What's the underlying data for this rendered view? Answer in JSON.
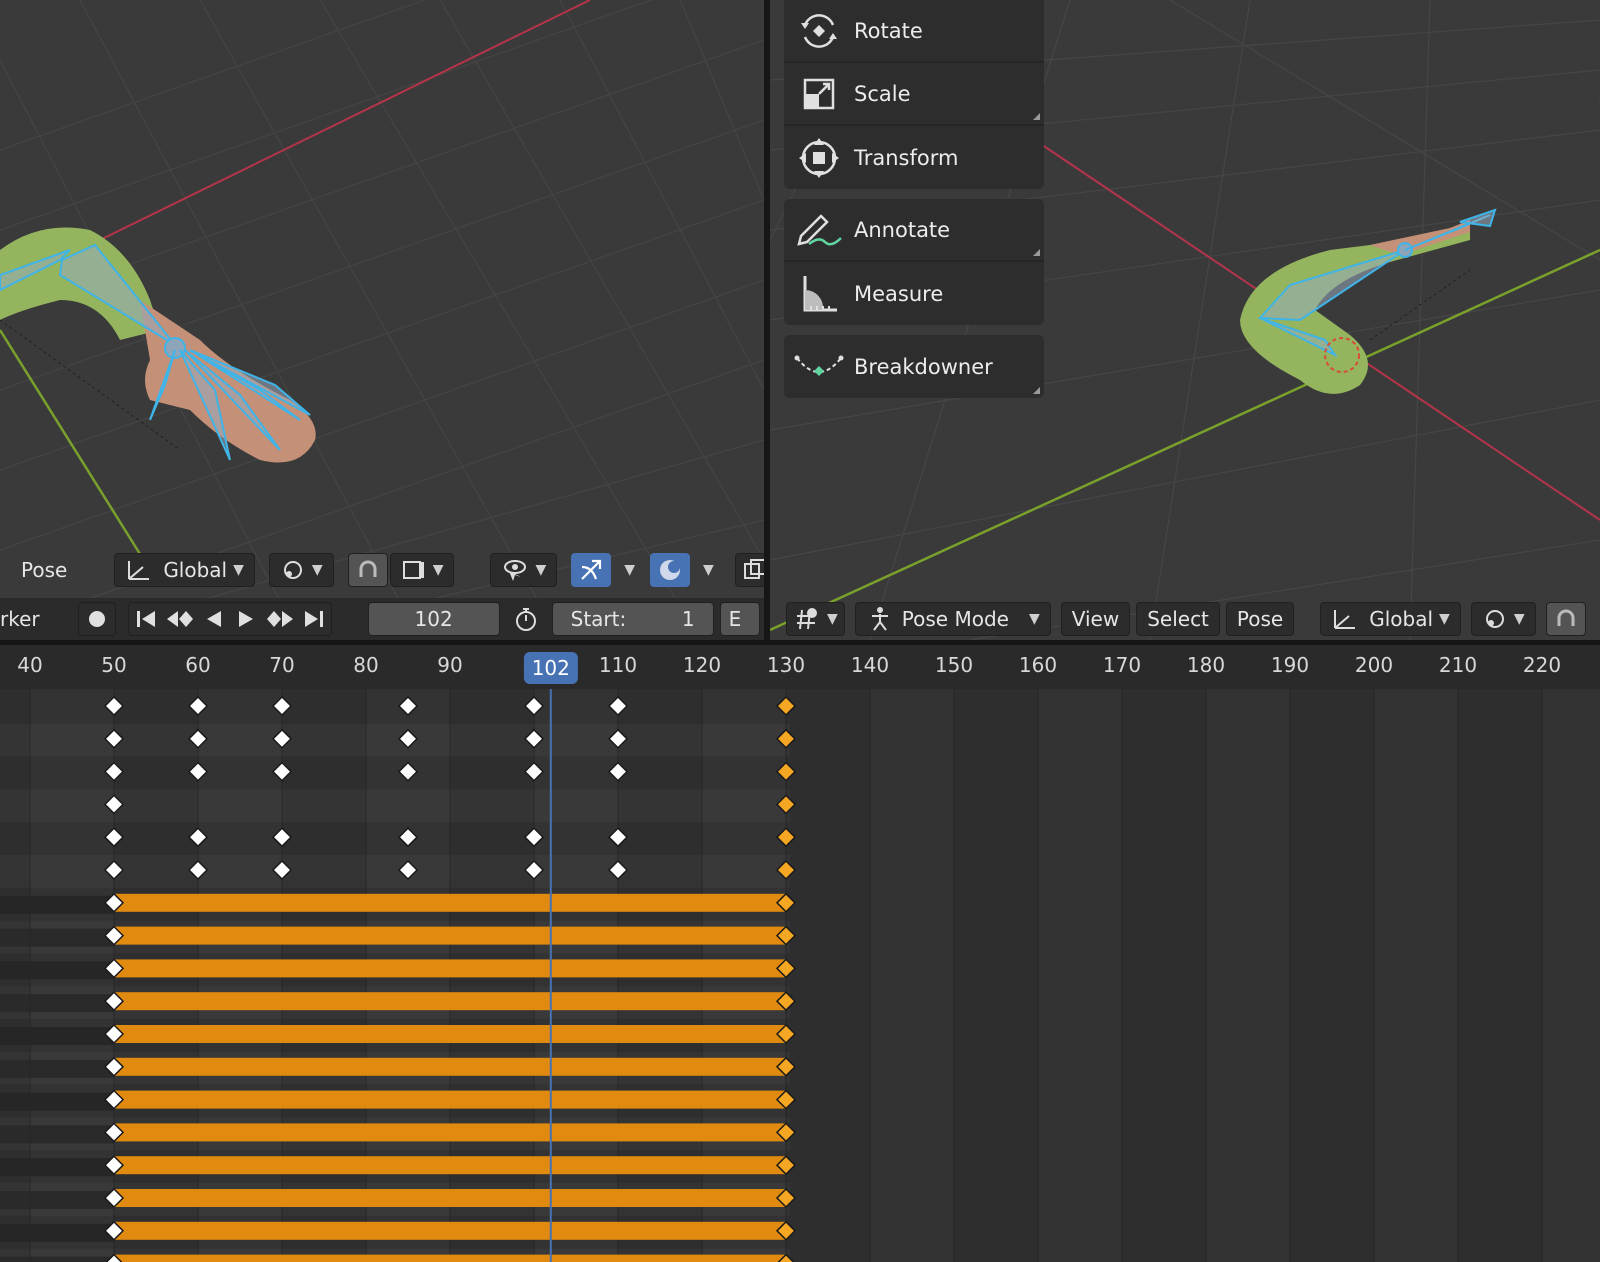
{
  "tools": [
    {
      "label": "Rotate",
      "icon": "rotate-icon"
    },
    {
      "label": "Scale",
      "icon": "scale-icon"
    },
    {
      "label": "Transform",
      "icon": "transform-icon"
    },
    {
      "label": "Annotate",
      "icon": "annotate-icon"
    },
    {
      "label": "Measure",
      "icon": "measure-icon"
    },
    {
      "label": "Breakdowner",
      "icon": "breakdowner-icon"
    }
  ],
  "left_header": {
    "menu_pose": "Pose",
    "orientation": "Global"
  },
  "right_header": {
    "mode": "Pose Mode",
    "menu_view": "View",
    "menu_select": "Select",
    "menu_pose": "Pose",
    "orientation": "Global"
  },
  "timeline": {
    "marker_label": "rker",
    "current_frame": "102",
    "start_label": "Start:",
    "start_value": "1",
    "end_label_partial": "E"
  },
  "ruler": {
    "ticks": [
      "40",
      "50",
      "60",
      "70",
      "80",
      "90",
      "110",
      "120",
      "130",
      "140",
      "150",
      "160",
      "170",
      "180",
      "190",
      "200",
      "210",
      "220"
    ],
    "tick_frames": [
      40,
      50,
      60,
      70,
      80,
      90,
      110,
      120,
      130,
      140,
      150,
      160,
      170,
      180,
      190,
      200,
      210,
      220
    ],
    "partial_label": "1",
    "current_frame": "102"
  },
  "keyframes": {
    "frames": [
      50,
      60,
      70,
      85,
      100,
      110,
      130
    ],
    "rows_pattern": [
      [
        50,
        60,
        70,
        85,
        100,
        110,
        130
      ],
      [
        50,
        60,
        70,
        85,
        100,
        110,
        130
      ],
      [
        50,
        60,
        70,
        85,
        100,
        110,
        130
      ],
      [
        50,
        130
      ],
      [
        50,
        60,
        70,
        85,
        100,
        110,
        130
      ],
      [
        50,
        60,
        70,
        85,
        100,
        110,
        130
      ]
    ],
    "hold_rows": 12,
    "hold_start": 50,
    "hold_end": 130,
    "selected_frame": 130
  },
  "colors": {
    "accent": "#4772b3",
    "keyframe_selected": "#f5a623",
    "hold_bar": "#e08a10",
    "bone": "#3fb4e8",
    "mesh": "#94b55e",
    "skin": "#c49178",
    "axis_x": "#b4344a",
    "axis_y": "#7aa12c"
  }
}
